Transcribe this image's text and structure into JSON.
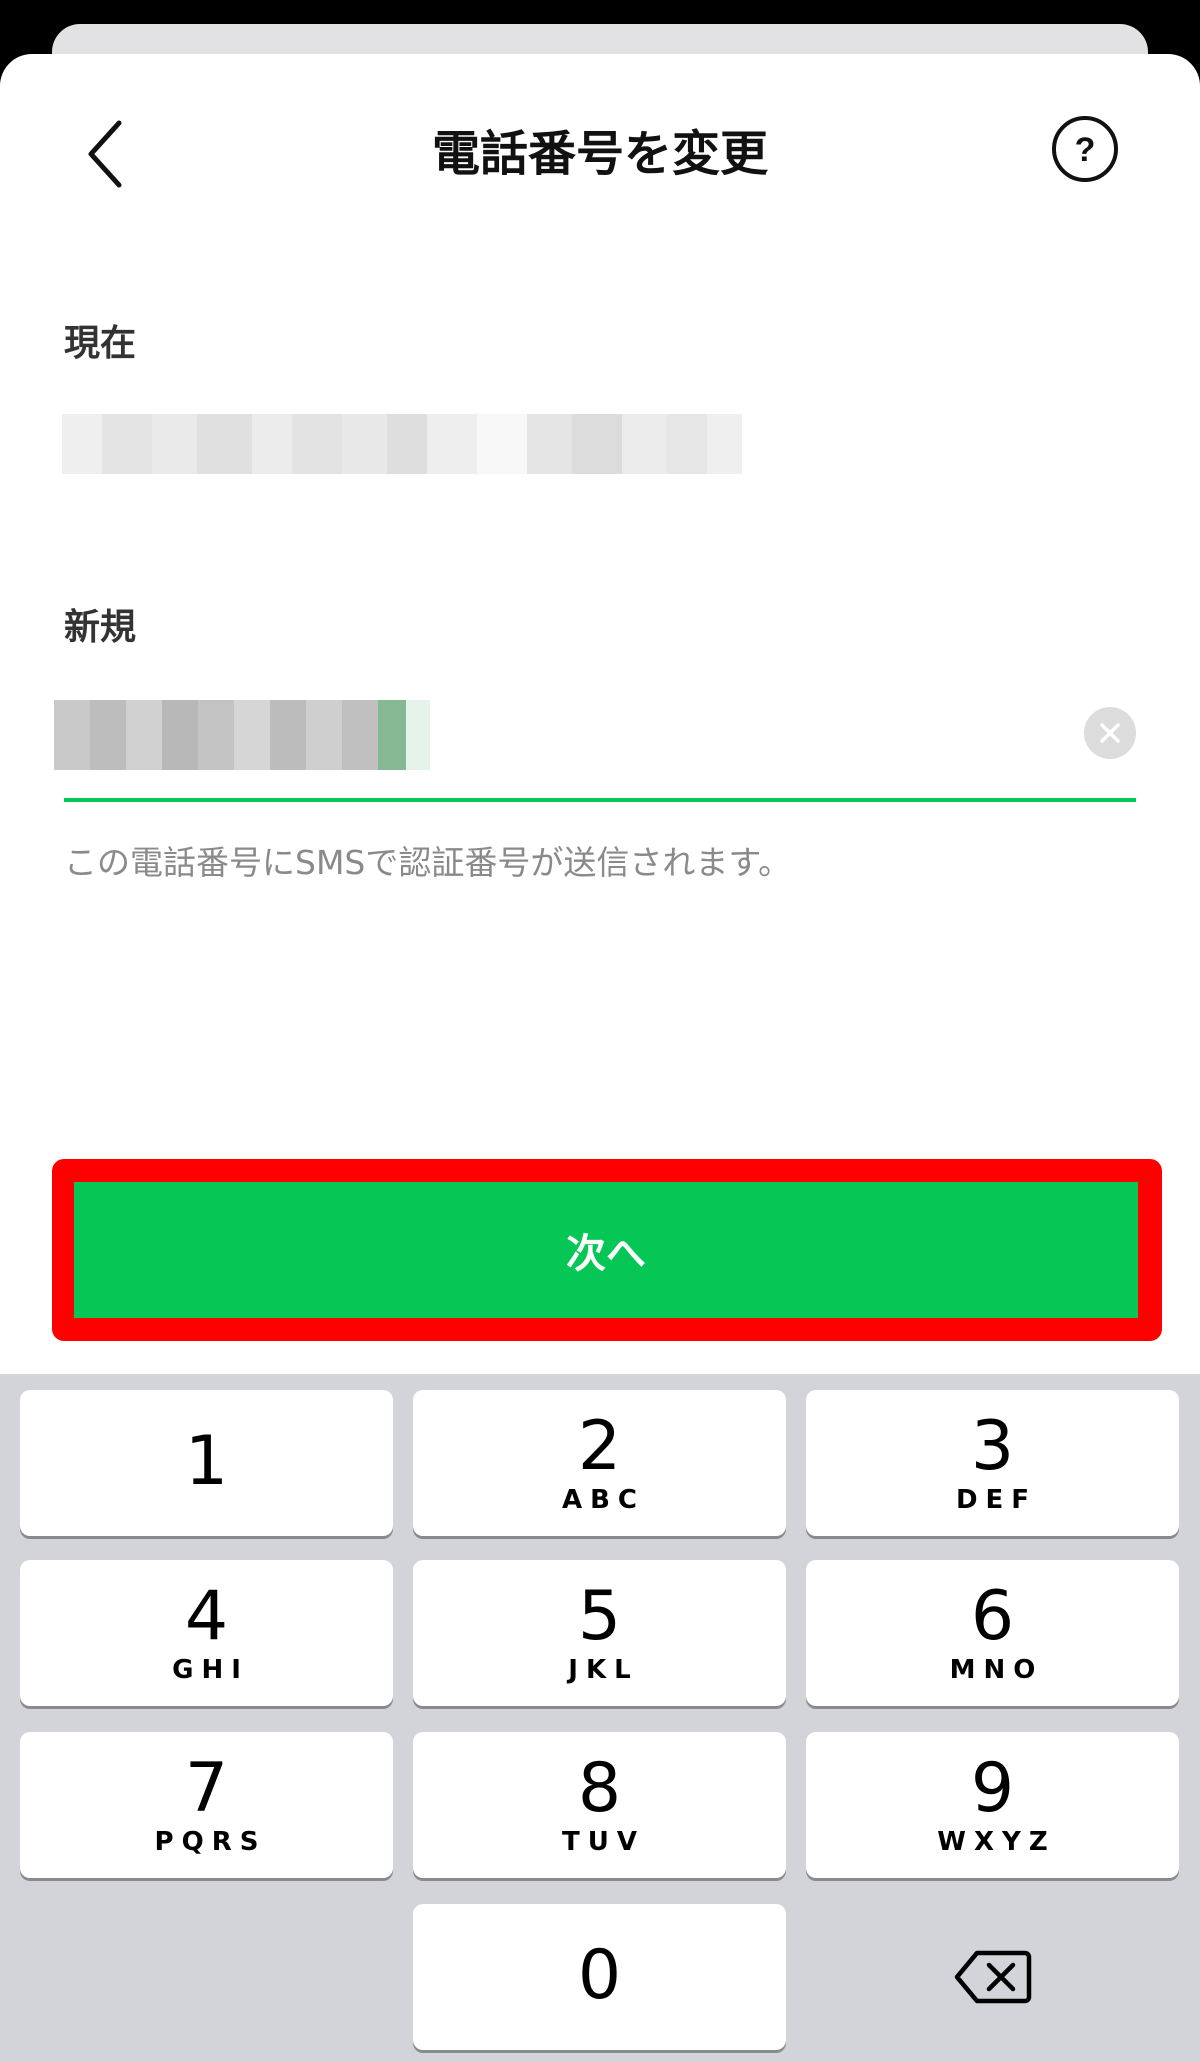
{
  "header": {
    "title": "電話番号を変更",
    "back_icon": "chevron-left-icon",
    "help_icon": "question-circle-icon",
    "help_glyph": "?"
  },
  "current": {
    "label": "現在"
  },
  "new_number": {
    "label": "新規",
    "clear_icon": "clear-x-icon",
    "helper_text": "この電話番号にSMSで認証番号が送信されます。"
  },
  "next_button": {
    "label": "次へ",
    "color": "#06c755",
    "highlight_color": "#ff0000"
  },
  "keypad": {
    "keys": [
      {
        "num": "1",
        "letters": ""
      },
      {
        "num": "2",
        "letters": "ABC"
      },
      {
        "num": "3",
        "letters": "DEF"
      },
      {
        "num": "4",
        "letters": "GHI"
      },
      {
        "num": "5",
        "letters": "JKL"
      },
      {
        "num": "6",
        "letters": "MNO"
      },
      {
        "num": "7",
        "letters": "PQRS"
      },
      {
        "num": "8",
        "letters": "TUV"
      },
      {
        "num": "9",
        "letters": "WXYZ"
      },
      {
        "num": "0",
        "letters": ""
      }
    ],
    "delete_icon": "backspace-icon"
  }
}
